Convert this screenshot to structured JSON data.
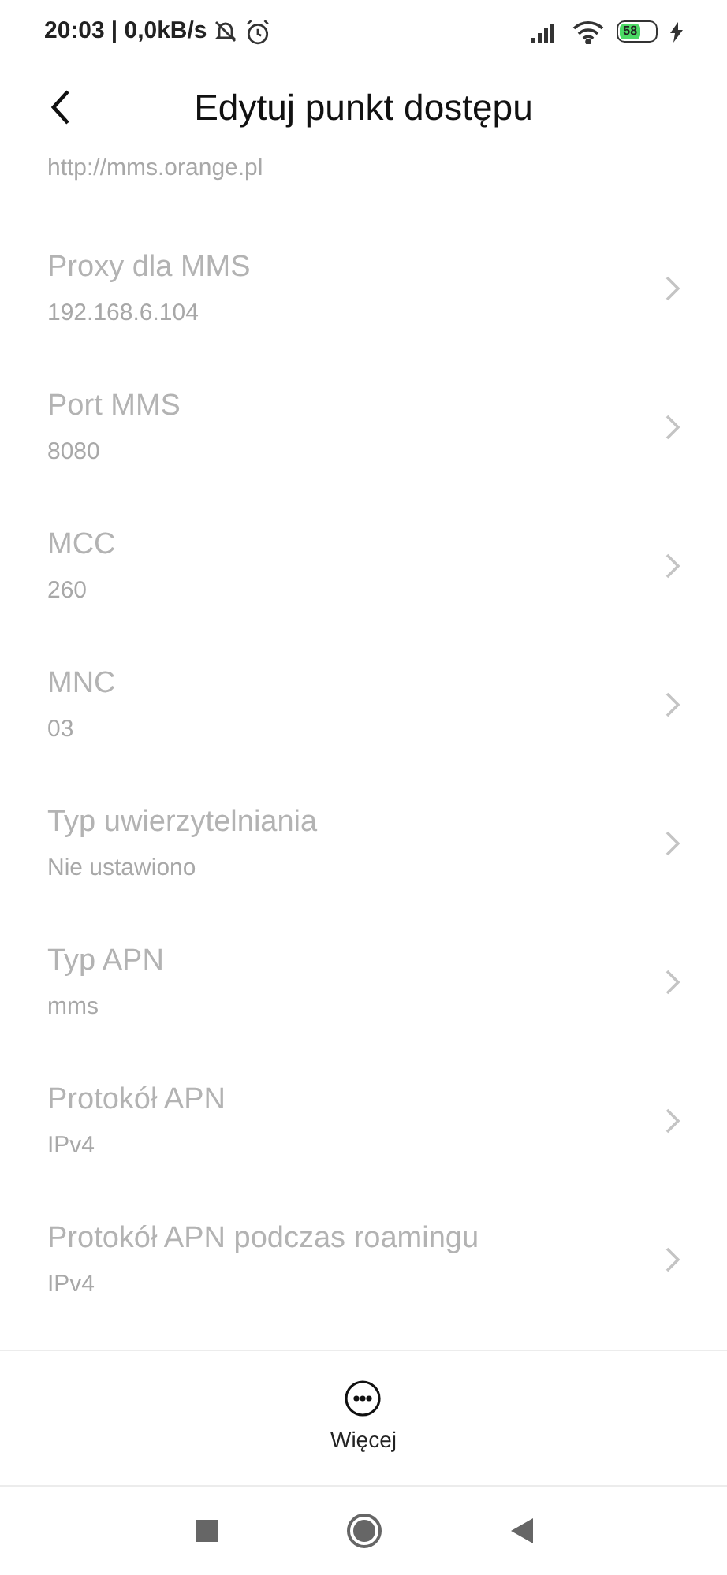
{
  "status_bar": {
    "time": "20:03",
    "speed": "| 0,0kB/s",
    "battery": "58"
  },
  "header": {
    "title": "Edytuj punkt dostępu"
  },
  "partial_item": {
    "value": "http://mms.orange.pl",
    "disabled": true
  },
  "items": [
    {
      "label": "Proxy dla MMS",
      "value": "192.168.6.104",
      "disabled": true
    },
    {
      "label": "Port MMS",
      "value": "8080",
      "disabled": true
    },
    {
      "label": "MCC",
      "value": "260",
      "disabled": true
    },
    {
      "label": "MNC",
      "value": "03",
      "disabled": true
    },
    {
      "label": "Typ uwierzytelniania",
      "value": "Nie ustawiono",
      "disabled": true
    },
    {
      "label": "Typ APN",
      "value": "mms",
      "disabled": true
    },
    {
      "label": "Protokół APN",
      "value": "IPv4",
      "disabled": true
    },
    {
      "label": "Protokół APN podczas roamingu",
      "value": "IPv4",
      "disabled": true
    }
  ],
  "more_button": {
    "label": "Więcej"
  }
}
